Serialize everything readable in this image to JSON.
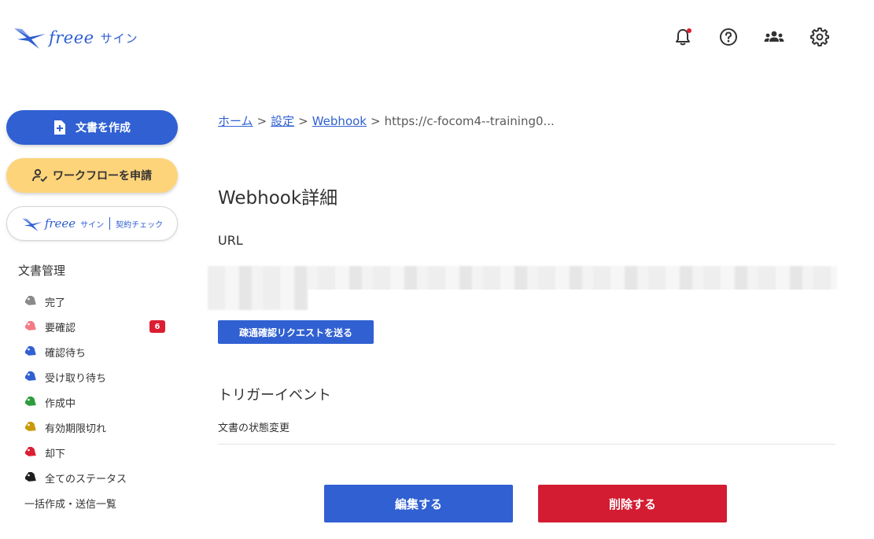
{
  "header": {
    "logo_brand": "freee",
    "logo_product": "サイン",
    "icons": [
      "bell-icon",
      "help-icon",
      "team-icon",
      "gear-icon"
    ],
    "notification_dot_color": "#dc1e32"
  },
  "sidebar": {
    "create_label": "文書を作成",
    "workflow_label": "ワークフローを申請",
    "contract_check": {
      "brand": "freee",
      "product": "サイン",
      "label": "契約チェック"
    },
    "section_title": "文書管理",
    "items": [
      {
        "label": "完了",
        "color": "#8a8a8a"
      },
      {
        "label": "要確認",
        "color": "#f27c86",
        "badge": "6"
      },
      {
        "label": "確認待ち",
        "color": "#3060d2"
      },
      {
        "label": "受け取り待ち",
        "color": "#3060d2"
      },
      {
        "label": "作成中",
        "color": "#2e9c3e"
      },
      {
        "label": "有効期限切れ",
        "color": "#c99a08"
      },
      {
        "label": "却下",
        "color": "#dc1e32"
      },
      {
        "label": "全てのステータス",
        "color": "#1e1e1e"
      }
    ],
    "bulk_label": "一括作成・送信一覧"
  },
  "breadcrumb": {
    "home": "ホーム",
    "settings": "設定",
    "webhook": "Webhook",
    "current": "https://c-focom4--training0...",
    "separator": ">"
  },
  "main": {
    "title": "Webhook詳細",
    "url_label": "URL",
    "test_button": "疎通確認リクエストを送る",
    "trigger_title": "トリガーイベント",
    "trigger_value": "文書の状態変更",
    "edit_button": "編集する",
    "delete_button": "削除する"
  },
  "colors": {
    "primary": "#3060d2",
    "danger": "#d31c32",
    "workflow": "#fdd47a"
  }
}
